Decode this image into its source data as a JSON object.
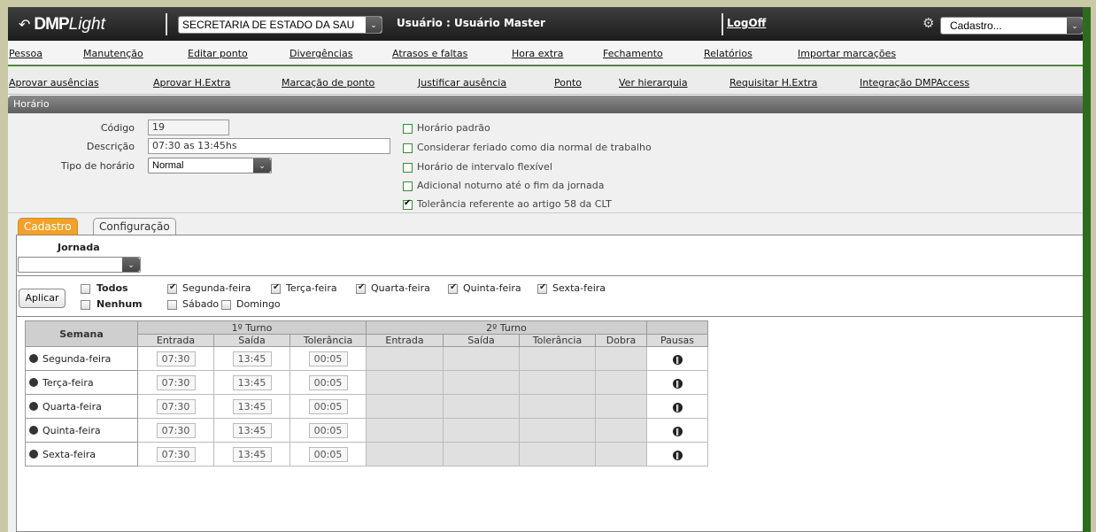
{
  "topbar": {
    "logo_brand": "DMP",
    "logo_product": "Light",
    "org_select": "SECRETARIA DE ESTADO DA SAU",
    "user_label": "Usuário : Usuário Master",
    "logoff": "LogOff",
    "cadastro_select": "Cadastro..."
  },
  "menu1": [
    "Pessoa",
    "Manutenção",
    "Editar ponto",
    "Divergências",
    "Atrasos e faltas",
    "Hora extra",
    "Fechamento",
    "Relatórios",
    "Importar marcações"
  ],
  "menu2": [
    "Aprovar ausências",
    "Aprovar H.Extra",
    "Marcação de ponto",
    "Justificar ausência",
    "Ponto",
    "Ver hierarquia",
    "Requisitar H.Extra",
    "Integração DMPAccess"
  ],
  "panel": {
    "title": "Horário",
    "codigo_label": "Código",
    "codigo_value": "19",
    "descricao_label": "Descrição",
    "descricao_value": "07:30 as 13:45hs",
    "tipo_label": "Tipo de horário",
    "tipo_value": "Normal",
    "options": [
      {
        "label": "Horário padrão",
        "checked": false
      },
      {
        "label": "Considerar feriado como dia normal de trabalho",
        "checked": false
      },
      {
        "label": "Horário de intervalo flexível",
        "checked": false
      },
      {
        "label": "Adicional noturno até o fim da jornada",
        "checked": false
      },
      {
        "label": "Tolerância referente ao artigo 58 da CLT",
        "checked": true
      }
    ]
  },
  "tabs": {
    "active": "Cadastro",
    "other": "Configuração"
  },
  "jornada": {
    "label": "Jornada",
    "value": ""
  },
  "days": {
    "apply_button": "Aplicar",
    "todos": "Todos",
    "nenhum": "Nenhum",
    "checks": [
      {
        "label": "Segunda-feira",
        "checked": true
      },
      {
        "label": "Terça-feira",
        "checked": true
      },
      {
        "label": "Quarta-feira",
        "checked": true
      },
      {
        "label": "Quinta-feira",
        "checked": true
      },
      {
        "label": "Sexta-feira",
        "checked": true
      },
      {
        "label": "Sábado",
        "checked": false
      },
      {
        "label": "Domingo",
        "checked": false
      }
    ]
  },
  "grid": {
    "semana": "Semana",
    "turno1": "1º Turno",
    "turno2": "2º Turno",
    "cols": [
      "Entrada",
      "Saída",
      "Tolerância",
      "Entrada",
      "Saída",
      "Tolerância",
      "Dobra",
      "Pausas"
    ],
    "rows": [
      {
        "day": "Segunda-feira",
        "entrada": "07:30",
        "saida": "13:45",
        "tol": "00:05"
      },
      {
        "day": "Terça-feira",
        "entrada": "07:30",
        "saida": "13:45",
        "tol": "00:05"
      },
      {
        "day": "Quarta-feira",
        "entrada": "07:30",
        "saida": "13:45",
        "tol": "00:05"
      },
      {
        "day": "Quinta-feira",
        "entrada": "07:30",
        "saida": "13:45",
        "tol": "00:05"
      },
      {
        "day": "Sexta-feira",
        "entrada": "07:30",
        "saida": "13:45",
        "tol": "00:05"
      }
    ]
  },
  "colors": {
    "accent_green": "#4a8c3a",
    "tab_active": "#f3a12b",
    "topbar": "#2a2a2a"
  }
}
